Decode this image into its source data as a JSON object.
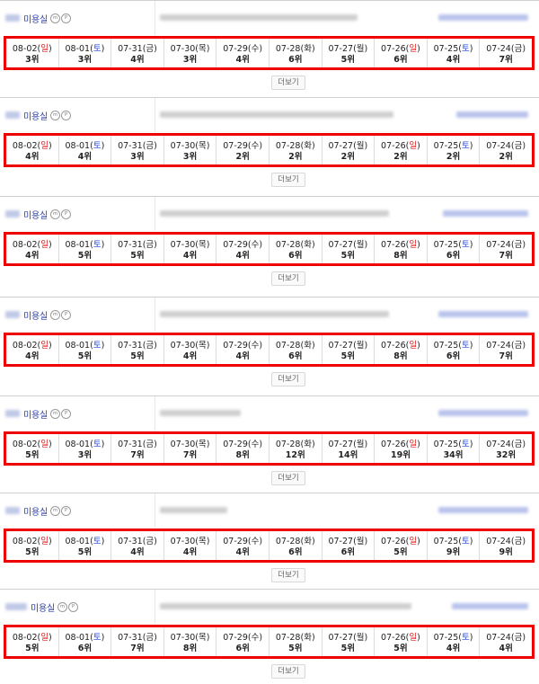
{
  "colors": {
    "highlight_border": "#ee0000",
    "sunday": "#e02020",
    "saturday": "#1c3fd8",
    "shop_link": "#2b3ea8"
  },
  "more_label": "더보기",
  "badges": [
    "m",
    "P"
  ],
  "dates": [
    {
      "date": "08-02",
      "day": "일",
      "kind": "sun"
    },
    {
      "date": "08-01",
      "day": "토",
      "kind": "sat"
    },
    {
      "date": "07-31",
      "day": "금",
      "kind": "wk"
    },
    {
      "date": "07-30",
      "day": "목",
      "kind": "wk"
    },
    {
      "date": "07-29",
      "day": "수",
      "kind": "wk"
    },
    {
      "date": "07-28",
      "day": "화",
      "kind": "wk"
    },
    {
      "date": "07-27",
      "day": "월",
      "kind": "wk"
    },
    {
      "date": "07-26",
      "day": "일",
      "kind": "sun"
    },
    {
      "date": "07-25",
      "day": "토",
      "kind": "sat"
    },
    {
      "date": "07-24",
      "day": "금",
      "kind": "wk"
    }
  ],
  "entries": [
    {
      "shop_name": "미용실",
      "ranks": [
        "3위",
        "3위",
        "4위",
        "3위",
        "4위",
        "6위",
        "5위",
        "6위",
        "4위",
        "7위"
      ]
    },
    {
      "shop_name": "미용실",
      "ranks": [
        "4위",
        "4위",
        "3위",
        "3위",
        "2위",
        "2위",
        "2위",
        "2위",
        "2위",
        "2위"
      ]
    },
    {
      "shop_name": "미용실",
      "ranks": [
        "4위",
        "5위",
        "5위",
        "4위",
        "4위",
        "6위",
        "5위",
        "8위",
        "6위",
        "7위"
      ]
    },
    {
      "shop_name": "미용실",
      "ranks": [
        "4위",
        "5위",
        "5위",
        "4위",
        "4위",
        "6위",
        "5위",
        "8위",
        "6위",
        "7위"
      ]
    },
    {
      "shop_name": "미용실",
      "ranks": [
        "5위",
        "3위",
        "7위",
        "7위",
        "8위",
        "12위",
        "14위",
        "19위",
        "34위",
        "32위"
      ]
    },
    {
      "shop_name": "미용실",
      "ranks": [
        "5위",
        "5위",
        "4위",
        "4위",
        "4위",
        "6위",
        "6위",
        "5위",
        "9위",
        "9위"
      ]
    },
    {
      "shop_name": "미용실",
      "ranks": [
        "5위",
        "6위",
        "7위",
        "8위",
        "6위",
        "5위",
        "5위",
        "5위",
        "4위",
        "4위"
      ]
    }
  ]
}
